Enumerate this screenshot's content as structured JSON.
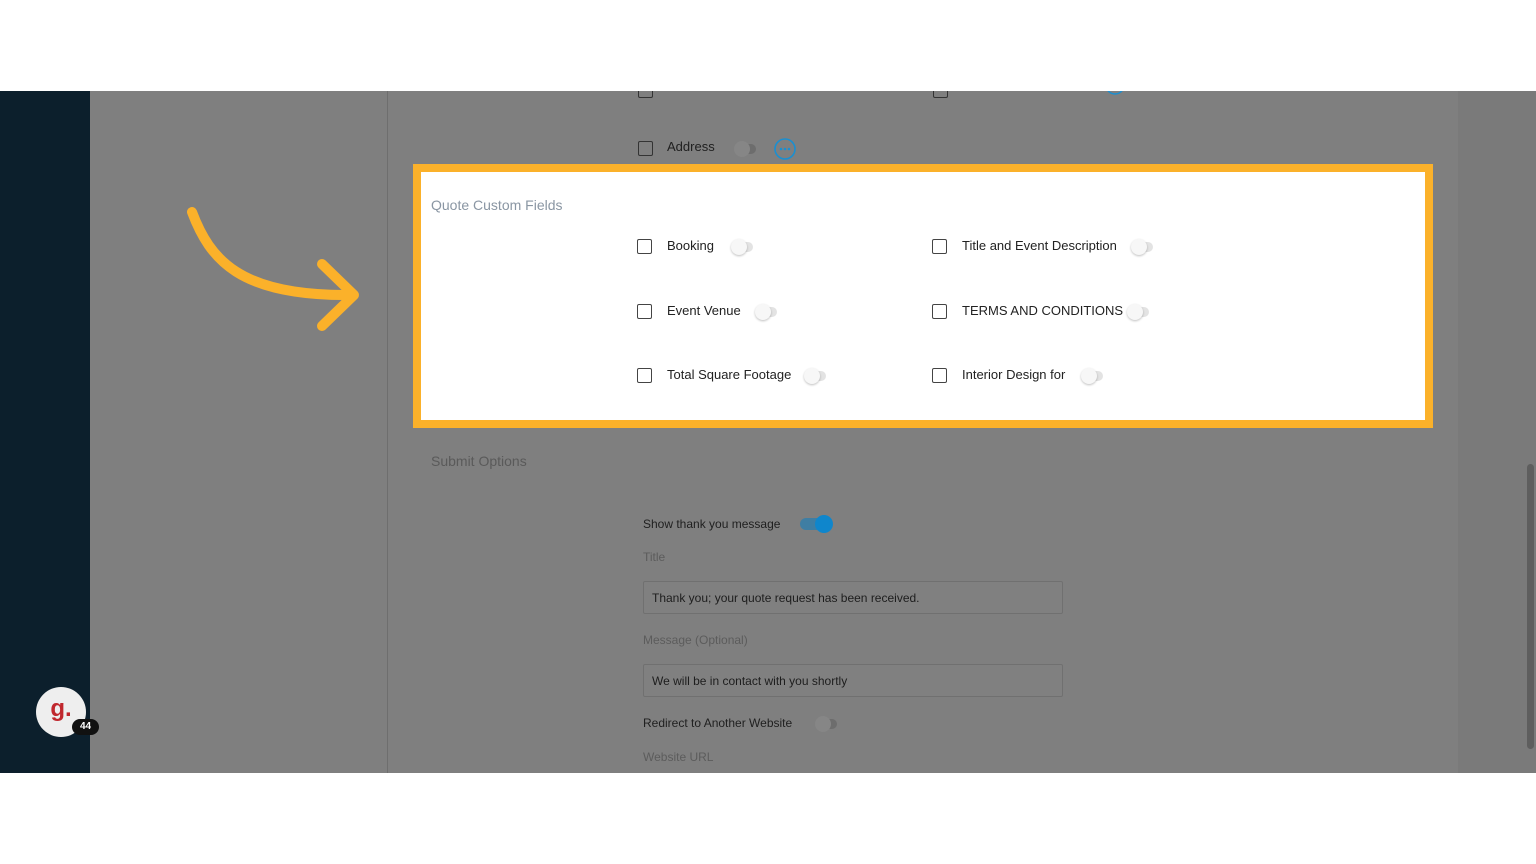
{
  "visible_fields_top": {
    "address_label": "Address"
  },
  "quote_custom_fields": {
    "title": "Quote Custom Fields",
    "items": [
      {
        "label": "Booking",
        "enabled": false
      },
      {
        "label": "Title and Event Description",
        "enabled": false
      },
      {
        "label": "Event Venue",
        "enabled": false
      },
      {
        "label": "TERMS AND CONDITIONS",
        "enabled": false
      },
      {
        "label": "Total Square Footage",
        "enabled": false
      },
      {
        "label": "Interior Design for",
        "enabled": false
      }
    ]
  },
  "submit_options": {
    "title": "Submit Options",
    "show_thank_you_label": "Show thank you message",
    "show_thank_you_enabled": true,
    "title_label": "Title",
    "title_value": "Thank you; your quote request has been received.",
    "message_label": "Message (Optional)",
    "message_value": "We will be in contact with you shortly",
    "redirect_label": "Redirect to Another Website",
    "redirect_enabled": false,
    "website_url_label": "Website URL"
  },
  "avatar": {
    "letter": "g.",
    "badge_count": "44"
  },
  "colors": {
    "highlight": "#fbb12a",
    "toggle_on": "#1a8fd1",
    "sidebar": "#0c1f2c",
    "avatar_letter": "#c0272d"
  },
  "icons": [
    "more-options-icon",
    "annotation-arrow-icon"
  ]
}
